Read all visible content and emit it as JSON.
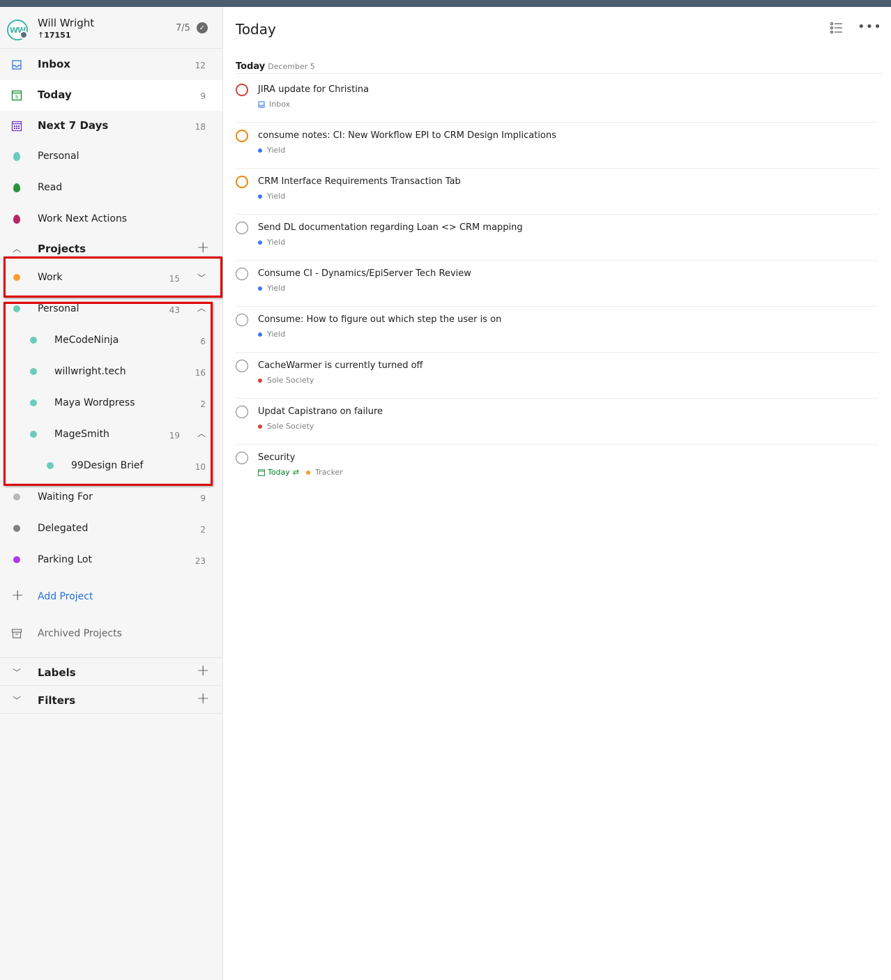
{
  "user": {
    "name": "Will Wright",
    "karma": "17151",
    "goal": "7/5",
    "initials": "WW"
  },
  "nav": [
    {
      "label": "Inbox",
      "count": "12"
    },
    {
      "label": "Today",
      "count": "9"
    },
    {
      "label": "Next 7 Days",
      "count": "18"
    }
  ],
  "filters_quick": [
    {
      "label": "Personal",
      "color": "#6accbc"
    },
    {
      "label": "Read",
      "color": "#299438"
    },
    {
      "label": "Work Next Actions",
      "color": "#b8255f"
    }
  ],
  "projects": {
    "heading": "Projects",
    "items": [
      {
        "label": "Work",
        "count": "15",
        "color": "#ff9933"
      },
      {
        "label": "Personal",
        "count": "43",
        "color": "#6accbc"
      },
      {
        "label": "MeCodeNinja",
        "count": "6",
        "color": "#6accbc"
      },
      {
        "label": "willwright.tech",
        "count": "16",
        "color": "#6accbc"
      },
      {
        "label": "Maya Wordpress",
        "count": "2",
        "color": "#6accbc"
      },
      {
        "label": "MageSmith",
        "count": "19",
        "color": "#6accbc"
      },
      {
        "label": "99Design Brief",
        "count": "10",
        "color": "#6accbc"
      },
      {
        "label": "Waiting For",
        "count": "9",
        "color": "#b8b8b8"
      },
      {
        "label": "Delegated",
        "count": "2",
        "color": "#808080"
      },
      {
        "label": "Parking Lot",
        "count": "23",
        "color": "#af38eb"
      }
    ],
    "add_label": "Add Project",
    "archived_label": "Archived Projects"
  },
  "labels_heading": "Labels",
  "filters_heading": "Filters",
  "main": {
    "title": "Today",
    "section_title": "Today",
    "section_date": "December 5",
    "tasks": [
      {
        "title": "JIRA update for Christina",
        "project": "Inbox",
        "priority": "p1"
      },
      {
        "title": "consume notes: CI: New Workflow EPI to CRM Design Implications",
        "project": "Yield",
        "priority": "p2"
      },
      {
        "title": "CRM Interface Requirements Transaction Tab",
        "project": "Yield",
        "priority": "p2"
      },
      {
        "title": "Send DL documentation regarding Loan <> CRM mapping",
        "project": "Yield",
        "priority": "p4"
      },
      {
        "title": "Consume CI - Dynamics/EpiServer Tech Review",
        "project": "Yield",
        "priority": "p4"
      },
      {
        "title": "Consume: How to figure out which step the user is on",
        "project": "Yield",
        "priority": "p4"
      },
      {
        "title": "CacheWarmer is currently turned off",
        "project": "Sole Society",
        "priority": "p4"
      },
      {
        "title": "Updat Capistrano on failure",
        "project": "Sole Society",
        "priority": "p4"
      },
      {
        "title": "Security",
        "due": "Today",
        "project": "Tracker",
        "priority": "p4"
      }
    ]
  },
  "colors": {
    "yield": "#4073ff",
    "sole_society": "#db4035",
    "tracker": "#ff9933",
    "highlight": "#e00000"
  }
}
